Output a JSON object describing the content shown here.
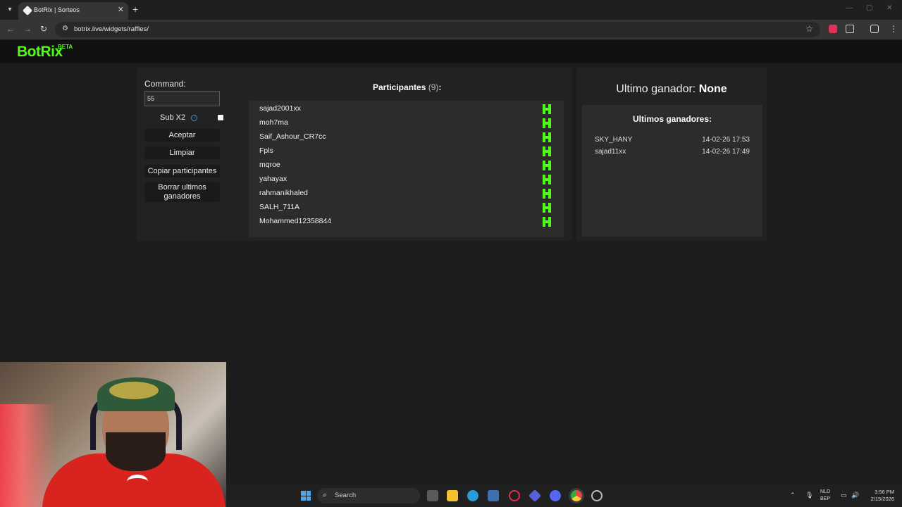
{
  "browser": {
    "tab_title": "BotRix | Sorteos",
    "url": "botrix.live/widgets/raffles/"
  },
  "logo": {
    "text": "BotRix",
    "badge": "BETA"
  },
  "command": {
    "label": "Command:",
    "value": "55"
  },
  "sub_x2": {
    "label": "Sub X2",
    "checked": false
  },
  "buttons": {
    "accept": "Aceptar",
    "clear": "Limpiar",
    "copy": "Copiar participantes",
    "delete_winners": "Borrar ultimos ganadores"
  },
  "participants": {
    "title": "Participantes",
    "count": "(9)",
    "colon": ":",
    "list": [
      "sajad2001xx",
      "moh7ma",
      "Saif_Ashour_CR7cc",
      "Fpls",
      "mqroe",
      "yahayax",
      "rahmanikhaled",
      "SALH_711A",
      "Mohammed12358844"
    ]
  },
  "last_winner": {
    "label": "Ultimo ganador:",
    "value": "None"
  },
  "recent_winners": {
    "title": "Ultimos ganadores:",
    "rows": [
      {
        "name": "SKY_HANY",
        "date": "14-02-26 17:53"
      },
      {
        "name": "sajad11xx",
        "date": "14-02-26 17:49"
      }
    ]
  },
  "taskbar": {
    "search_placeholder": "Search",
    "lang_line1": "NLD",
    "lang_line2": "BEP",
    "time": "3:56 PM",
    "date": "2/15/2026"
  },
  "colors": {
    "accent": "#53fc18",
    "background": "#1c1c1c",
    "panel": "#222222"
  }
}
